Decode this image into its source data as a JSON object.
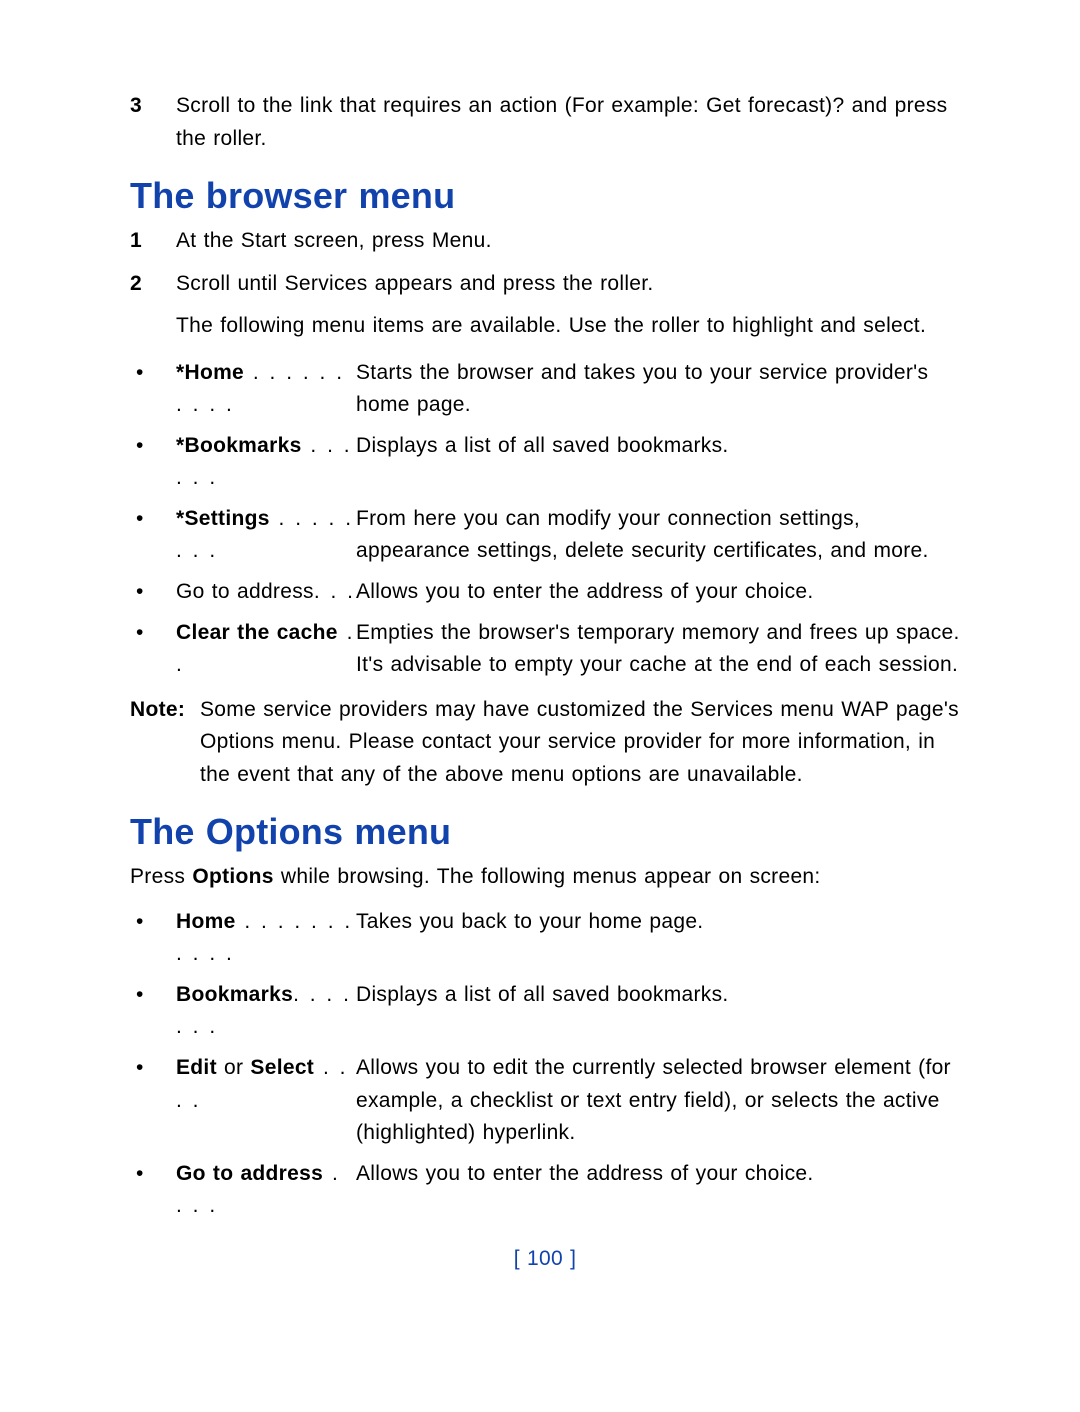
{
  "step3": {
    "num": "3",
    "text_a": "Scroll to the link that requires an action (For example: ",
    "text_b": "Get forecast",
    "text_c": ")? and press the roller."
  },
  "heading1": "The browser menu",
  "step_bm_1": {
    "num": "1",
    "a": "At the Start screen, press ",
    "b": "Menu",
    "c": "."
  },
  "step_bm_2": {
    "num": "2",
    "a": "Scroll until ",
    "b": "Services",
    "c": " appears and press the roller."
  },
  "bm_para": "The following menu items are available. Use the roller to highlight and select.",
  "bm_items": [
    {
      "term": "*Home",
      "leader": " . . . . . . . . . .",
      "desc": "Starts the browser and takes you to your service provider's home page."
    },
    {
      "term": "*Bookmarks",
      "leader": " . . . . . .",
      "desc": "Displays a list of all saved bookmarks."
    },
    {
      "term": "*Settings",
      "leader": " . . . . . . . .",
      "desc": "From here you can modify your connection settings, appearance settings, delete security certificates, and more."
    },
    {
      "term": "Go to address",
      "leader": ". . .",
      "desc": "Allows you to enter the address of your choice."
    },
    {
      "term": "Clear the cache",
      "leader": " . .",
      "desc": "Empties the browser's temporary memory and frees up space. It's advisable to empty your cache at the end of each session."
    }
  ],
  "note": {
    "label": "Note:",
    "body": "Some service providers may have customized the Services menu WAP page's Options menu. Please contact your service provider for more information, in the event that any of the above menu options are unavailable."
  },
  "heading2": "The Options menu",
  "opt_intro_a": "Press ",
  "opt_intro_b": "Options",
  "opt_intro_c": " while browsing. The following menus appear on screen:",
  "opt_items": [
    {
      "term": "Home",
      "leader": " . . . . . . . . . . .",
      "desc": "Takes you back to your home page."
    },
    {
      "term": "Bookmarks",
      "leader": ". . . . . . .",
      "desc": "Displays a list of all saved bookmarks."
    },
    {
      "term_a": "Edit",
      "mid": " or ",
      "term_b": "Select",
      "leader": " . . . .",
      "desc": "Allows you to edit the currently selected browser element (for example, a checklist or text entry field), or selects the active (highlighted) hyperlink."
    },
    {
      "term": "Go to address",
      "leader": " . . . .",
      "desc": "Allows you to enter the address of your choice."
    }
  ],
  "page_number": "[ 100 ]"
}
